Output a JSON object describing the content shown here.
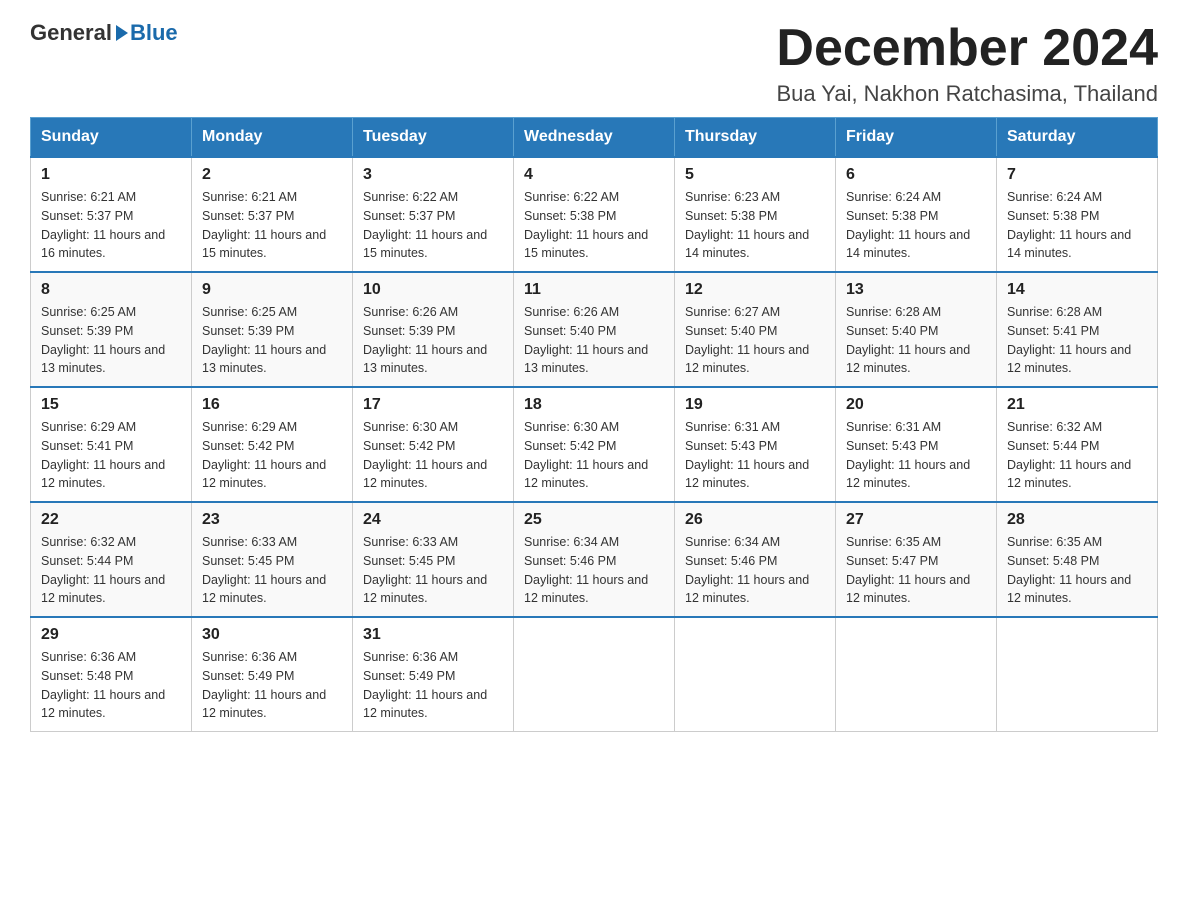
{
  "logo": {
    "general": "General",
    "blue": "Blue"
  },
  "title": "December 2024",
  "subtitle": "Bua Yai, Nakhon Ratchasima, Thailand",
  "days_header": [
    "Sunday",
    "Monday",
    "Tuesday",
    "Wednesday",
    "Thursday",
    "Friday",
    "Saturday"
  ],
  "weeks": [
    [
      {
        "day": "1",
        "sunrise": "6:21 AM",
        "sunset": "5:37 PM",
        "daylight": "11 hours and 16 minutes."
      },
      {
        "day": "2",
        "sunrise": "6:21 AM",
        "sunset": "5:37 PM",
        "daylight": "11 hours and 15 minutes."
      },
      {
        "day": "3",
        "sunrise": "6:22 AM",
        "sunset": "5:37 PM",
        "daylight": "11 hours and 15 minutes."
      },
      {
        "day": "4",
        "sunrise": "6:22 AM",
        "sunset": "5:38 PM",
        "daylight": "11 hours and 15 minutes."
      },
      {
        "day": "5",
        "sunrise": "6:23 AM",
        "sunset": "5:38 PM",
        "daylight": "11 hours and 14 minutes."
      },
      {
        "day": "6",
        "sunrise": "6:24 AM",
        "sunset": "5:38 PM",
        "daylight": "11 hours and 14 minutes."
      },
      {
        "day": "7",
        "sunrise": "6:24 AM",
        "sunset": "5:38 PM",
        "daylight": "11 hours and 14 minutes."
      }
    ],
    [
      {
        "day": "8",
        "sunrise": "6:25 AM",
        "sunset": "5:39 PM",
        "daylight": "11 hours and 13 minutes."
      },
      {
        "day": "9",
        "sunrise": "6:25 AM",
        "sunset": "5:39 PM",
        "daylight": "11 hours and 13 minutes."
      },
      {
        "day": "10",
        "sunrise": "6:26 AM",
        "sunset": "5:39 PM",
        "daylight": "11 hours and 13 minutes."
      },
      {
        "day": "11",
        "sunrise": "6:26 AM",
        "sunset": "5:40 PM",
        "daylight": "11 hours and 13 minutes."
      },
      {
        "day": "12",
        "sunrise": "6:27 AM",
        "sunset": "5:40 PM",
        "daylight": "11 hours and 12 minutes."
      },
      {
        "day": "13",
        "sunrise": "6:28 AM",
        "sunset": "5:40 PM",
        "daylight": "11 hours and 12 minutes."
      },
      {
        "day": "14",
        "sunrise": "6:28 AM",
        "sunset": "5:41 PM",
        "daylight": "11 hours and 12 minutes."
      }
    ],
    [
      {
        "day": "15",
        "sunrise": "6:29 AM",
        "sunset": "5:41 PM",
        "daylight": "11 hours and 12 minutes."
      },
      {
        "day": "16",
        "sunrise": "6:29 AM",
        "sunset": "5:42 PM",
        "daylight": "11 hours and 12 minutes."
      },
      {
        "day": "17",
        "sunrise": "6:30 AM",
        "sunset": "5:42 PM",
        "daylight": "11 hours and 12 minutes."
      },
      {
        "day": "18",
        "sunrise": "6:30 AM",
        "sunset": "5:42 PM",
        "daylight": "11 hours and 12 minutes."
      },
      {
        "day": "19",
        "sunrise": "6:31 AM",
        "sunset": "5:43 PM",
        "daylight": "11 hours and 12 minutes."
      },
      {
        "day": "20",
        "sunrise": "6:31 AM",
        "sunset": "5:43 PM",
        "daylight": "11 hours and 12 minutes."
      },
      {
        "day": "21",
        "sunrise": "6:32 AM",
        "sunset": "5:44 PM",
        "daylight": "11 hours and 12 minutes."
      }
    ],
    [
      {
        "day": "22",
        "sunrise": "6:32 AM",
        "sunset": "5:44 PM",
        "daylight": "11 hours and 12 minutes."
      },
      {
        "day": "23",
        "sunrise": "6:33 AM",
        "sunset": "5:45 PM",
        "daylight": "11 hours and 12 minutes."
      },
      {
        "day": "24",
        "sunrise": "6:33 AM",
        "sunset": "5:45 PM",
        "daylight": "11 hours and 12 minutes."
      },
      {
        "day": "25",
        "sunrise": "6:34 AM",
        "sunset": "5:46 PM",
        "daylight": "11 hours and 12 minutes."
      },
      {
        "day": "26",
        "sunrise": "6:34 AM",
        "sunset": "5:46 PM",
        "daylight": "11 hours and 12 minutes."
      },
      {
        "day": "27",
        "sunrise": "6:35 AM",
        "sunset": "5:47 PM",
        "daylight": "11 hours and 12 minutes."
      },
      {
        "day": "28",
        "sunrise": "6:35 AM",
        "sunset": "5:48 PM",
        "daylight": "11 hours and 12 minutes."
      }
    ],
    [
      {
        "day": "29",
        "sunrise": "6:36 AM",
        "sunset": "5:48 PM",
        "daylight": "11 hours and 12 minutes."
      },
      {
        "day": "30",
        "sunrise": "6:36 AM",
        "sunset": "5:49 PM",
        "daylight": "11 hours and 12 minutes."
      },
      {
        "day": "31",
        "sunrise": "6:36 AM",
        "sunset": "5:49 PM",
        "daylight": "11 hours and 12 minutes."
      },
      null,
      null,
      null,
      null
    ]
  ]
}
